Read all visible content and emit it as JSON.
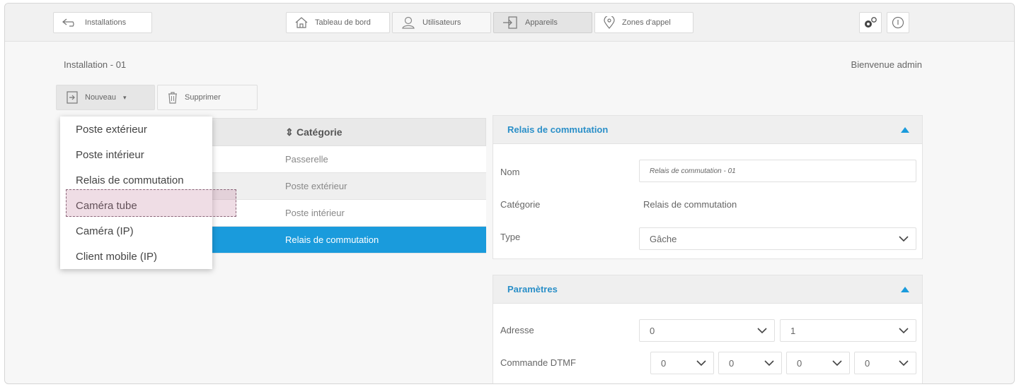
{
  "topbar": {
    "installations_label": "Installations",
    "tabs": [
      {
        "label": "Tableau de bord",
        "icon": "home-icon"
      },
      {
        "label": "Utilisateurs",
        "icon": "user-icon"
      },
      {
        "label": "Appareils",
        "icon": "device-login-icon",
        "active": true
      },
      {
        "label": "Zones d'appel",
        "icon": "location-pin-icon"
      }
    ],
    "right_icons": [
      "settings-gears-icon",
      "info-icon"
    ]
  },
  "breadcrumb": "Installation - 01",
  "welcome": "Bienvenue admin",
  "actions": {
    "nouveau_label": "Nouveau",
    "supprimer_label": "Supprimer"
  },
  "table": {
    "column_header": "Catégorie",
    "rows": [
      "Passerelle",
      "Poste extérieur",
      "Poste intérieur",
      "Relais de commutation"
    ],
    "selected_index": 3
  },
  "dropdown_menu": {
    "items": [
      "Poste extérieur",
      "Poste intérieur",
      "Relais de commutation",
      "Caméra tube",
      "Caméra (IP)",
      "Client mobile (IP)"
    ],
    "highlighted_index": 3
  },
  "panel_relais": {
    "title": "Relais de commutation",
    "nom_label": "Nom",
    "nom_value": "Relais de commutation - 01",
    "categorie_label": "Catégorie",
    "categorie_value": "Relais de commutation",
    "type_label": "Type",
    "type_value": "Gâche"
  },
  "panel_parametres": {
    "title": "Paramètres",
    "adresse_label": "Adresse",
    "adresse_values": [
      "0",
      "1"
    ],
    "dtmf_label": "Commande DTMF",
    "dtmf_values": [
      "0",
      "0",
      "0",
      "0"
    ]
  },
  "colors": {
    "accent": "#1a9bdc",
    "title_blue": "#2a8fc8",
    "highlight": "#be7896"
  }
}
